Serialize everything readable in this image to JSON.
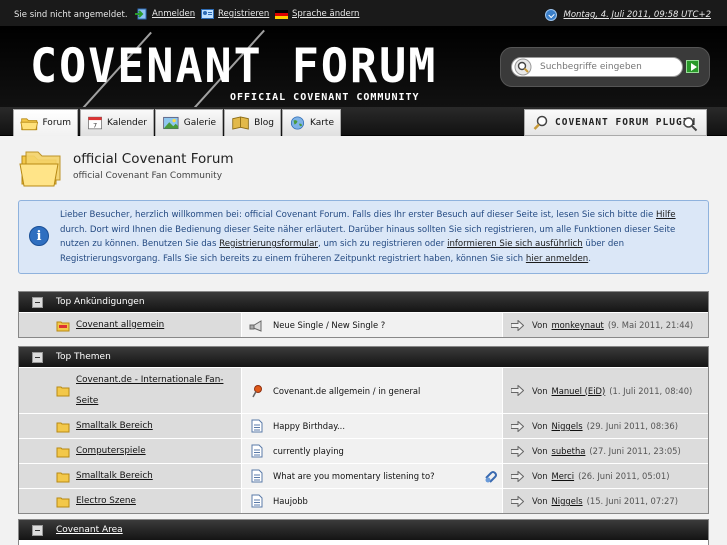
{
  "topbar": {
    "status": "Sie sind nicht angemeldet.",
    "links": [
      {
        "label": "Anmelden",
        "icon": "login-icon"
      },
      {
        "label": "Registrieren",
        "icon": "register-icon"
      },
      {
        "label": "Sprache ändern",
        "icon": "flag-de-icon"
      }
    ],
    "datetime": "Montag, 4. Juli 2011, 09:58 UTC+2"
  },
  "header": {
    "logo": "COVENANT FORUM",
    "tagline": "OFFICIAL COVENANT COMMUNITY",
    "search_placeholder": "Suchbegriffe eingeben"
  },
  "nav": {
    "tabs": [
      {
        "label": "Forum",
        "icon": "forum-folder-icon",
        "active": true
      },
      {
        "label": "Kalender",
        "icon": "calendar-icon"
      },
      {
        "label": "Galerie",
        "icon": "gallery-icon"
      },
      {
        "label": "Blog",
        "icon": "blog-icon"
      },
      {
        "label": "Karte",
        "icon": "globe-icon"
      }
    ],
    "plugin_label": "COVENANT FORUM PLUGIN"
  },
  "page": {
    "title": "official Covenant Forum",
    "subtitle": "official Covenant Fan Community"
  },
  "info": {
    "t1": "Lieber Besucher, herzlich willkommen bei: official Covenant Forum. Falls dies Ihr erster Besuch auf dieser Seite ist, lesen Sie sich bitte die ",
    "l1": "Hilfe",
    "t2": " durch. Dort wird Ihnen die Bedienung dieser Seite näher erläutert. Darüber hinaus sollten Sie sich registrieren, um alle Funktionen dieser Seite nutzen zu können. Benutzen Sie das ",
    "l2": "Registrierungsformular",
    "t3": ", um sich zu registrieren oder ",
    "l3": "informieren Sie sich ausführlich",
    "t4": " über den Registrierungsvorgang. Falls Sie sich bereits zu einem früheren Zeitpunkt registriert haben, können Sie sich ",
    "l4": "hier anmelden",
    "t5": "."
  },
  "sections": [
    {
      "title": "Top Ankündigungen",
      "rows": [
        {
          "forum": "Covenant allgemein",
          "topic": "Neue Single / New Single ?",
          "von": "Von",
          "user": "monkeynaut",
          "date": "(9. Mai 2011, 21:44)"
        }
      ]
    },
    {
      "title": "Top Themen",
      "rows": [
        {
          "forum": "Covenant.de - Internationale Fan-Seite",
          "topic": "Covenant.de allgemein / in general",
          "von": "Von",
          "user": "Manuel (EiD)",
          "date": "(1. Juli 2011, 08:40)"
        },
        {
          "forum": "Smalltalk Bereich",
          "topic": "Happy Birthday...",
          "von": "Von",
          "user": "Niggels",
          "date": "(29. Juni 2011, 08:36)"
        },
        {
          "forum": "Computerspiele",
          "topic": "currently playing",
          "von": "Von",
          "user": "subetha",
          "date": "(27. Juni 2011, 23:05)"
        },
        {
          "forum": "Smalltalk Bereich",
          "topic": "What are you momentary listening to?",
          "von": "Von",
          "user": "Merci",
          "date": "(26. Juni 2011, 05:01)"
        },
        {
          "forum": "Electro Szene",
          "topic": "Haujobb",
          "von": "Von",
          "user": "Niggels",
          "date": "(15. Juni 2011, 07:27)"
        }
      ]
    },
    {
      "title": "Covenant Area",
      "rows": []
    }
  ],
  "colors": {
    "topbar": "#1a1a1a",
    "info_bg": "#dbe7f7",
    "info_text": "#244a82",
    "section_head": "#1e1e1e"
  }
}
